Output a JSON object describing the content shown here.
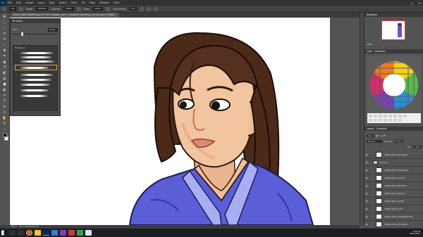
{
  "menubar": {
    "app_icon": "Ps",
    "items": [
      "File",
      "Edit",
      "Image",
      "Layer",
      "Type",
      "Select",
      "Filter",
      "3D",
      "View",
      "Window",
      "Help"
    ],
    "window_controls": [
      "–",
      "□",
      "✕"
    ]
  },
  "options": {
    "mode_label": "Mode:",
    "mode_value": "Normal",
    "opacity_label": "Opacity:",
    "opacity_value": "100%",
    "flow_label": "Flow:",
    "flow_value": "100%",
    "smoothing_label": "Smoothing:",
    "smoothing_value": "0%"
  },
  "document": {
    "tab_title": "ZSU83_NEW DINNER.psd @ 250% (debbie_face_f_breathed_standing_normal copy, RGB/8) *"
  },
  "brush_panel": {
    "title": "Brushes",
    "size_label": "Size:",
    "size_value": "44 px",
    "group_label": "Brushes 1",
    "brush_count": 9,
    "selected_index": 4
  },
  "status": {
    "zoom": "250%",
    "doc_info": "Doc: 38.9M/264.3M"
  },
  "navigator": {
    "title": "Navigator",
    "zoom": "250%"
  },
  "color_panel": {
    "tabs": [
      "Color",
      "Swatches"
    ]
  },
  "layers_panel": {
    "tabs": [
      "Layers",
      "Channels"
    ],
    "blend_mode": "Normal",
    "opacity_label": "Opacity:",
    "opacity_value": "100%",
    "fill_label": "Fill:",
    "fill_value": "100%",
    "layers": [
      {
        "name": "debbie_face_f_breathed",
        "folder": false,
        "visible": true
      },
      {
        "name": "Group 1",
        "folder": true,
        "visible": true
      },
      {
        "name": "debbie_face_f_surprised",
        "folder": false,
        "visible": true
      },
      {
        "name": "debbie_face_f_normal",
        "folder": false,
        "visible": true
      },
      {
        "name": "debbie_face_f_blushed",
        "folder": false,
        "visible": true
      },
      {
        "name": "debbie_face_f_angry",
        "folder": false,
        "visible": true
      },
      {
        "name": "debbie_face_f_smile",
        "folder": false,
        "visible": true
      },
      {
        "name": "debbie_face_f_sad",
        "folder": false,
        "visible": true
      },
      {
        "name": "debbie_face_f_breathed copy",
        "folder": false,
        "visible": true
      },
      {
        "name": "debbie_face_f_breathed",
        "folder": false,
        "visible": true
      },
      {
        "name": "skirt after",
        "folder": false,
        "visible": true
      }
    ]
  },
  "taskbar": {
    "time": "3:56 PM",
    "date": "20/01/2021"
  },
  "colors": {
    "menubar": "#323232",
    "panel": "#535353",
    "accent_selection": "#e8a13d",
    "robe": "#5b5fd6",
    "hair": "#4a2a1a",
    "skin": "#f0bf98"
  }
}
